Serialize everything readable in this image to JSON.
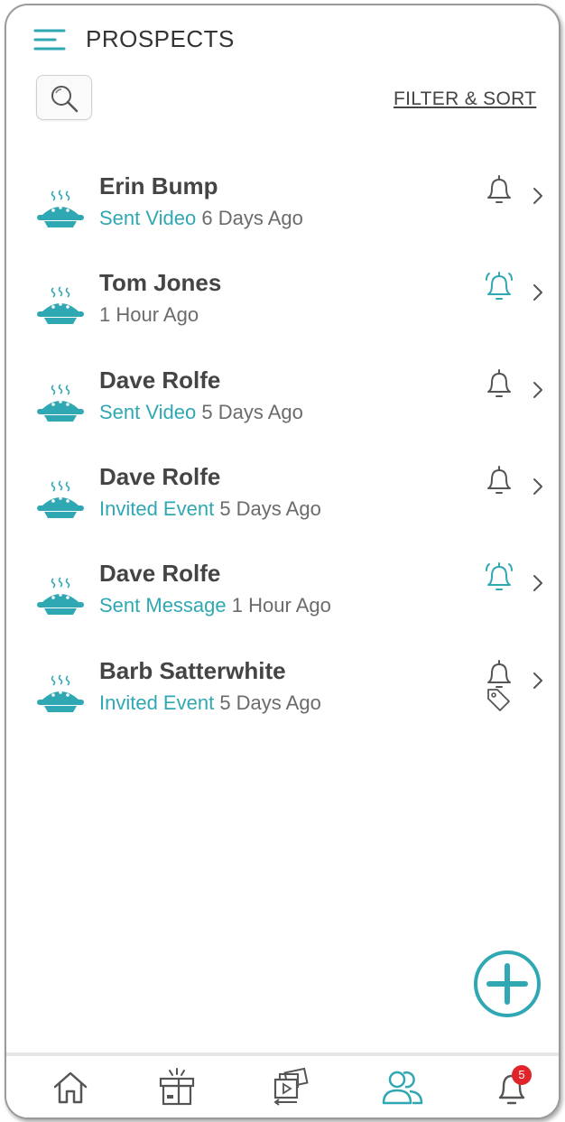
{
  "header": {
    "title": "PROSPECTS",
    "filter_label": "FILTER & SORT"
  },
  "colors": {
    "accent": "#2fa8b3",
    "text_dark": "#444444",
    "text_muted": "#6b6b6b",
    "badge": "#e0242a"
  },
  "prospects": [
    {
      "name": "Erin Bump",
      "action": "Sent Video",
      "time": "6 Days Ago",
      "bell_active": false,
      "tag": false
    },
    {
      "name": "Tom Jones",
      "action": "",
      "time": " 1 Hour Ago",
      "bell_active": true,
      "tag": false
    },
    {
      "name": "Dave Rolfe",
      "action": "Sent Video",
      "time": "5 Days Ago",
      "bell_active": false,
      "tag": false
    },
    {
      "name": "Dave Rolfe",
      "action": "Invited Event",
      "time": "5 Days Ago",
      "bell_active": false,
      "tag": false
    },
    {
      "name": "Dave Rolfe",
      "action": "Sent Message",
      "time": "1 Hour Ago",
      "bell_active": true,
      "tag": false
    },
    {
      "name": "Barb Satterwhite",
      "action": "Invited Event",
      "time": "5 Days Ago",
      "bell_active": false,
      "tag": true
    }
  ],
  "bottom_nav": {
    "items": [
      {
        "icon": "home-icon",
        "active": false
      },
      {
        "icon": "gift-box-icon",
        "active": false
      },
      {
        "icon": "media-library-icon",
        "active": false
      },
      {
        "icon": "people-icon",
        "active": true
      },
      {
        "icon": "bell-icon",
        "active": false
      }
    ],
    "notification_count": "5"
  },
  "icons": {
    "menu": "menu-icon",
    "search": "search-icon",
    "avatar": "pie-icon",
    "bell": "bell-icon",
    "tag": "tag-icon",
    "chevron": "chevron-right-icon",
    "add": "add-icon"
  }
}
